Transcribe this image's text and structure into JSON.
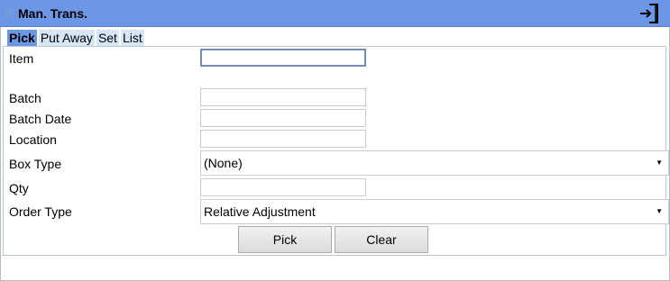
{
  "window": {
    "title": "Man. Trans."
  },
  "tabs": [
    {
      "label": "Pick",
      "active": true
    },
    {
      "label": "Put Away",
      "active": false
    },
    {
      "label": "Set",
      "active": false
    },
    {
      "label": "List",
      "active": false
    }
  ],
  "form": {
    "item_label": "Item",
    "item_value": "",
    "batch_label": "Batch",
    "batch_value": "",
    "batch_date_label": "Batch Date",
    "batch_date_value": "",
    "location_label": "Location",
    "location_value": "",
    "box_type_label": "Box Type",
    "box_type_value": "(None)",
    "qty_label": "Qty",
    "qty_value": "",
    "order_type_label": "Order Type",
    "order_type_value": "Relative Adjustment"
  },
  "buttons": {
    "pick": "Pick",
    "clear": "Clear"
  },
  "icons": {
    "pin": "pin-icon",
    "exit": "exit-icon",
    "dropdown": "chevron-down-icon"
  },
  "colors": {
    "titlebar": "#6b97e6",
    "tab_active": "#6b97e6",
    "tab_inactive": "#d6e6f7"
  }
}
